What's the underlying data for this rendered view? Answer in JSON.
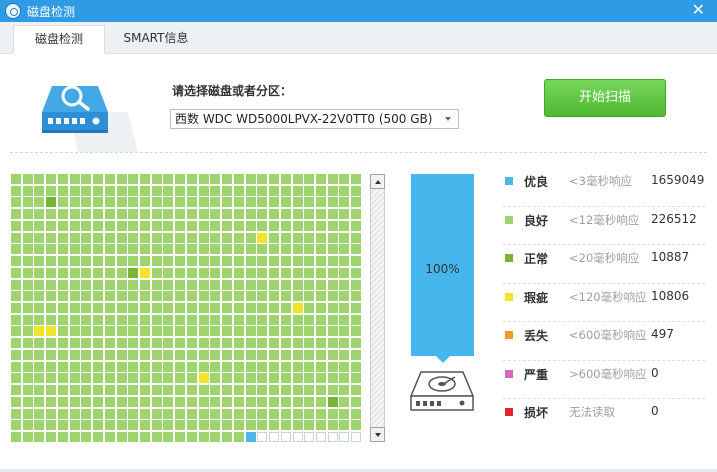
{
  "window": {
    "title": "磁盘检测",
    "close_glyph": "✕"
  },
  "tabs": [
    {
      "label": "磁盘检测",
      "active": true
    },
    {
      "label": "SMART信息",
      "active": false
    }
  ],
  "disk_selector": {
    "label": "请选择磁盘或者分区：",
    "selected": "西数 WDC WD5000LPVX-22V0TT0  (500 GB)"
  },
  "scan_button": {
    "label": "开始扫描"
  },
  "progress": {
    "percent": 1.0,
    "label": "100%"
  },
  "colors": {
    "excellent": "#4fb6e8",
    "good": "#9fd36f",
    "normal": "#79b534",
    "flaw": "#f1e52a",
    "lost": "#f39a2e",
    "severe": "#d16ac6",
    "bad": "#e3262a",
    "empty": "#ffffff",
    "accent": "#2f9be6"
  },
  "legend": [
    {
      "key": "excellent",
      "name": "优良",
      "range": "<3毫秒响应",
      "count": "1659049"
    },
    {
      "key": "good",
      "name": "良好",
      "range": "<12毫秒响应",
      "count": "226512"
    },
    {
      "key": "normal",
      "name": "正常",
      "range": "<20毫秒响应",
      "count": "10887"
    },
    {
      "key": "flaw",
      "name": "瑕疵",
      "range": "<120毫秒响应",
      "count": "10806"
    },
    {
      "key": "lost",
      "name": "丢失",
      "range": "<600毫秒响应",
      "count": "497"
    },
    {
      "key": "severe",
      "name": "严重",
      "range": ">600毫秒响应",
      "count": "0"
    },
    {
      "key": "bad",
      "name": "损坏",
      "range": "无法读取",
      "count": "0"
    }
  ],
  "block_map": {
    "columns": 30,
    "rows": 23,
    "default_state": "good",
    "marked_blocks": [
      {
        "row": 2,
        "col": 3,
        "state": "normal"
      },
      {
        "row": 5,
        "col": 21,
        "state": "flaw"
      },
      {
        "row": 8,
        "col": 10,
        "state": "normal"
      },
      {
        "row": 8,
        "col": 11,
        "state": "flaw"
      },
      {
        "row": 11,
        "col": 24,
        "state": "flaw"
      },
      {
        "row": 13,
        "col": 2,
        "state": "flaw"
      },
      {
        "row": 13,
        "col": 3,
        "state": "flaw"
      },
      {
        "row": 17,
        "col": 16,
        "state": "flaw"
      },
      {
        "row": 19,
        "col": 27,
        "state": "normal"
      },
      {
        "row": 22,
        "col": 20,
        "state": "excellent"
      }
    ],
    "empty_from": {
      "row": 22,
      "col": 21
    }
  }
}
